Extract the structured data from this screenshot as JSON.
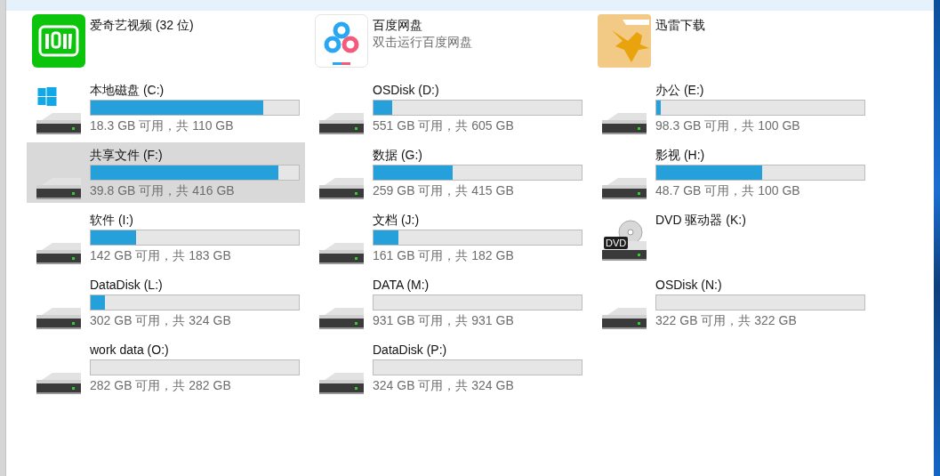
{
  "items": [
    {
      "kind": "app",
      "title": "爱奇艺视频 (32 位)",
      "selected": false
    },
    {
      "kind": "app",
      "title": "百度网盘",
      "subtitle": "双击运行百度网盘",
      "selected": false
    },
    {
      "kind": "app",
      "title": "迅雷下载",
      "selected": false
    },
    {
      "kind": "system_drive",
      "title": "本地磁盘 (C:)",
      "level": 0.83,
      "detail": "18.3 GB 可用，共 110 GB",
      "selected": false
    },
    {
      "kind": "drive",
      "title": "OSDisk (D:)",
      "level": 0.09,
      "detail": "551 GB 可用，共 605 GB",
      "selected": false
    },
    {
      "kind": "drive",
      "title": "办公 (E:)",
      "level": 0.02,
      "detail": "98.3 GB 可用，共 100 GB",
      "selected": false
    },
    {
      "kind": "drive",
      "title": "共享文件 (F:)",
      "level": 0.9,
      "detail": "39.8 GB 可用，共 416 GB",
      "selected": true
    },
    {
      "kind": "drive",
      "title": "数据 (G:)",
      "level": 0.38,
      "detail": "259 GB 可用，共 415 GB",
      "selected": false
    },
    {
      "kind": "drive",
      "title": "影视 (H:)",
      "level": 0.51,
      "detail": "48.7 GB 可用，共 100 GB",
      "selected": false
    },
    {
      "kind": "drive",
      "title": "软件 (I:)",
      "level": 0.22,
      "detail": "142 GB 可用，共 183 GB",
      "selected": false
    },
    {
      "kind": "drive",
      "title": "文档 (J:)",
      "level": 0.12,
      "detail": "161 GB 可用，共 182 GB",
      "selected": false
    },
    {
      "kind": "dvd_drive",
      "title": "DVD 驱动器 (K:)",
      "badge": "DVD",
      "selected": false
    },
    {
      "kind": "drive",
      "title": "DataDisk (L:)",
      "level": 0.07,
      "detail": "302 GB 可用，共 324 GB",
      "selected": false
    },
    {
      "kind": "drive",
      "title": "DATA (M:)",
      "level": 0,
      "detail": "931 GB 可用，共 931 GB",
      "selected": false
    },
    {
      "kind": "drive",
      "title": "OSDisk (N:)",
      "level": 0,
      "detail": "322 GB 可用，共 322 GB",
      "selected": false
    },
    {
      "kind": "drive",
      "title": "work data (O:)",
      "level": 0,
      "detail": "282 GB 可用，共 282 GB",
      "selected": false
    },
    {
      "kind": "drive",
      "title": "DataDisk (P:)",
      "level": 0,
      "detail": "324 GB 可用，共 324 GB",
      "selected": false
    }
  ]
}
